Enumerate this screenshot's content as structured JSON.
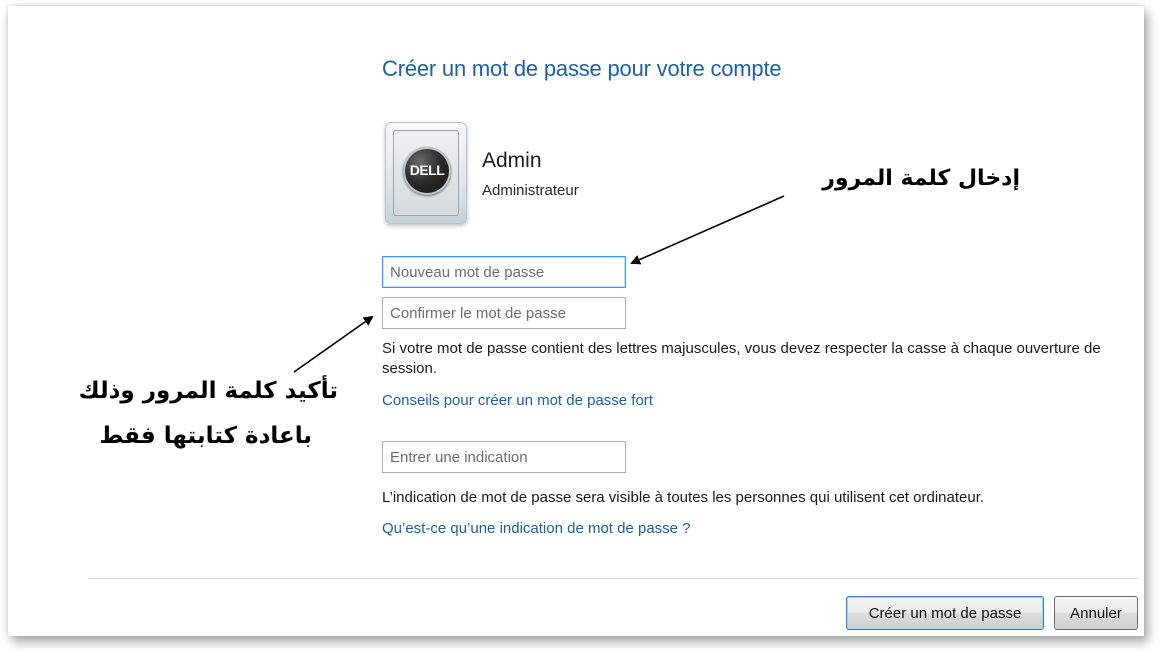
{
  "dialog": {
    "title": "Créer un mot de passe pour votre compte",
    "logo_text": "DELL",
    "user": {
      "name": "Admin",
      "role": "Administrateur"
    },
    "fields": {
      "new_password_placeholder": "Nouveau mot de passe",
      "confirm_password_placeholder": "Confirmer le mot de passe",
      "hint_placeholder": "Entrer une indication"
    },
    "case_info": "Si votre mot de passe contient des lettres majuscules, vous devez respecter la casse à chaque ouverture de session.",
    "strong_password_link": "Conseils pour créer un mot de passe fort",
    "hint_info": "L’indication de mot de passe sera visible à toutes les personnes qui utilisent cet ordinateur.",
    "hint_link": "Qu’est-ce qu’une indication de mot de passe ?",
    "buttons": {
      "create": "Créer un mot de passe",
      "cancel": "Annuler"
    }
  },
  "annotations": {
    "enter_password": "إدخال كلمة المرور",
    "confirm_line1": "تأكيد كلمة المرور وذلك",
    "confirm_line2": "باعادة كتابتها فقط"
  },
  "colors": {
    "title": "#1e5fa8",
    "link": "#1e5fa8",
    "focus_border": "#3399ff"
  }
}
